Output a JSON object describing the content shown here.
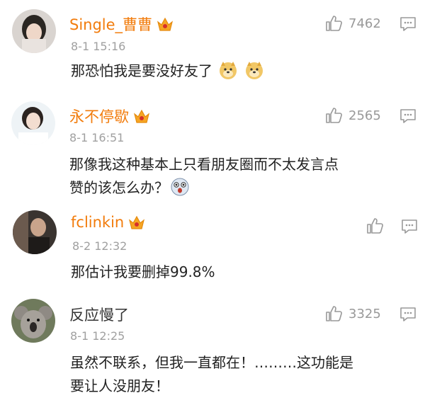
{
  "comments": [
    {
      "name": "Single_曹曹",
      "time": "8-1 15:16",
      "likes": "7462",
      "lines": [
        "那恐怕我是要没好友了"
      ]
    },
    {
      "name": "永不停歇",
      "time": "8-1 16:51",
      "likes": "2565",
      "lines": [
        "那像我这种基本上只看朋友圈而不太发言点",
        "赞的该怎么办？"
      ]
    },
    {
      "name": "fclinkin",
      "time": "8-2 12:32",
      "likes": "",
      "lines": [
        "那估计我要删掉99.8%"
      ]
    },
    {
      "name": "反应慢了",
      "time": "8-1 12:25",
      "likes": "3325",
      "lines": [
        "虽然不联系，但我一直都在！………这功能是",
        "要让人没朋友！"
      ]
    }
  ],
  "colors": {
    "name": "#f27c0c",
    "time": "#a0a0a0",
    "icon": "#999999"
  },
  "icons": {
    "like": "thumbs-up-icon",
    "reply": "comment-icon",
    "vip": "crown-badge-icon"
  }
}
